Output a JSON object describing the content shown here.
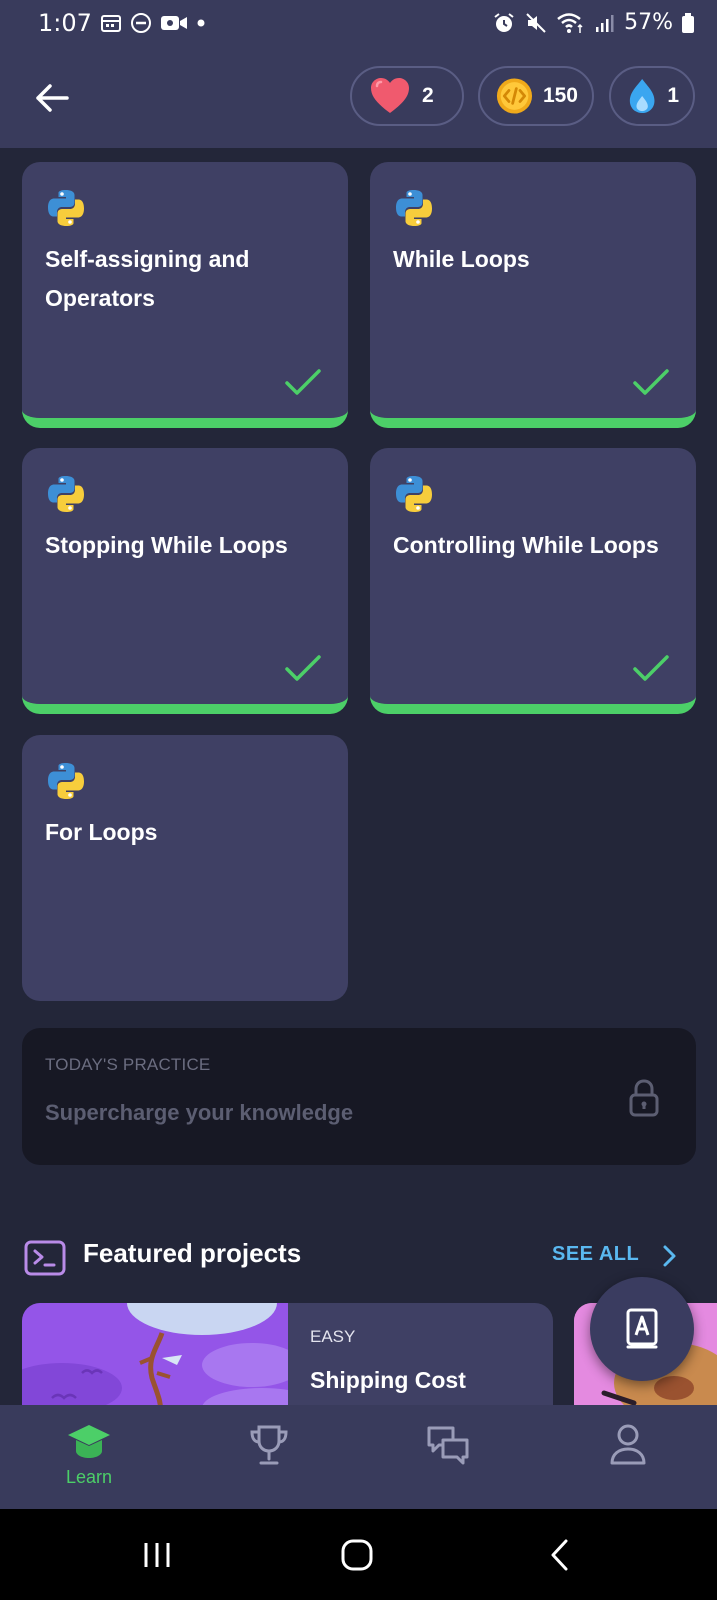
{
  "status_bar": {
    "time": "1:07",
    "battery": "57%"
  },
  "header": {
    "hearts": "2",
    "coins": "150",
    "streak": "1"
  },
  "lessons": [
    {
      "title": "Self-assigning and Operators",
      "completed": true
    },
    {
      "title": "While Loops",
      "completed": true
    },
    {
      "title": "Stopping While Loops",
      "completed": true
    },
    {
      "title": "Controlling While Loops",
      "completed": true
    },
    {
      "title": "For Loops",
      "completed": false
    }
  ],
  "practice": {
    "label": "TODAY'S PRACTICE",
    "title": "Supercharge your knowledge",
    "locked": true
  },
  "featured": {
    "title": "Featured projects",
    "see_all": "SEE ALL",
    "projects": [
      {
        "level": "EASY",
        "title": "Shipping Cost"
      }
    ]
  },
  "bottom_nav": {
    "items": [
      {
        "label": "Learn",
        "icon": "graduation-cap-icon",
        "active": true
      },
      {
        "label": "",
        "icon": "trophy-icon",
        "active": false
      },
      {
        "label": "",
        "icon": "chat-icon",
        "active": false
      },
      {
        "label": "",
        "icon": "profile-icon",
        "active": false
      }
    ]
  },
  "colors": {
    "background": "#232639",
    "card": "#3f4064",
    "accent_green": "#4ccf68",
    "link_blue": "#5ab8f0"
  }
}
